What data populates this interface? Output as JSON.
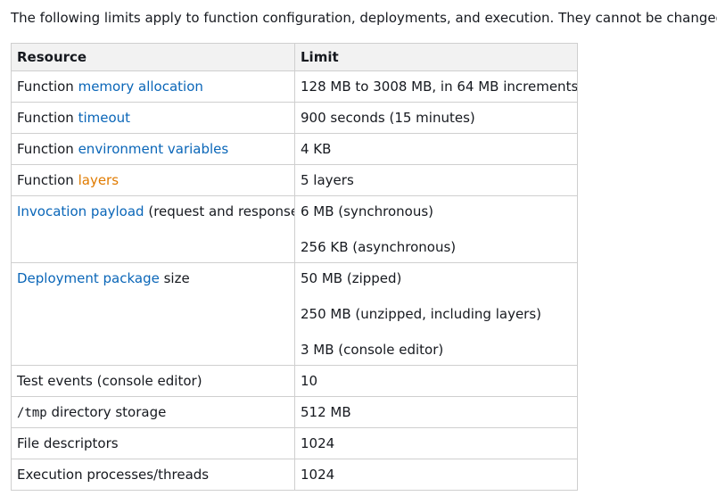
{
  "intro": "The following limits apply to function configuration, deployments, and execution. They cannot be changed.",
  "table": {
    "headers": {
      "resource": "Resource",
      "limit": "Limit"
    },
    "rows": [
      {
        "resource_prefix": "Function ",
        "resource_link": "memory allocation",
        "resource_suffix": "",
        "values": [
          "128 MB to 3008 MB, in 64 MB increments."
        ]
      },
      {
        "resource_prefix": "Function ",
        "resource_link": "timeout",
        "resource_suffix": "",
        "values": [
          "900 seconds (15 minutes)"
        ]
      },
      {
        "resource_prefix": "Function ",
        "resource_link": "environment variables",
        "resource_suffix": "",
        "values": [
          "4 KB"
        ]
      },
      {
        "resource_prefix": "Function ",
        "resource_link": "layers",
        "resource_suffix": "",
        "values": [
          "5 layers"
        ]
      },
      {
        "resource_prefix": "",
        "resource_link": "Invocation payload",
        "resource_suffix": " (request and response)",
        "values": [
          "6 MB (synchronous)",
          "256 KB (asynchronous)"
        ]
      },
      {
        "resource_prefix": "",
        "resource_link": "Deployment package",
        "resource_suffix": " size",
        "values": [
          "50 MB (zipped)",
          "250 MB (unzipped, including layers)",
          "3 MB (console editor)"
        ]
      },
      {
        "resource_text": "Test events (console editor)",
        "values": [
          "10"
        ]
      },
      {
        "resource_code": "/tmp",
        "resource_suffix": " directory storage",
        "values": [
          "512 MB"
        ]
      },
      {
        "resource_text": "File descriptors",
        "values": [
          "1024"
        ]
      },
      {
        "resource_text": "Execution processes/threads",
        "values": [
          "1024"
        ]
      }
    ]
  },
  "colors": {
    "link": "#0a66b8",
    "link_visited_layers": "#e07b00",
    "header_bg": "#f2f2f2",
    "border": "#cfcfcf"
  }
}
